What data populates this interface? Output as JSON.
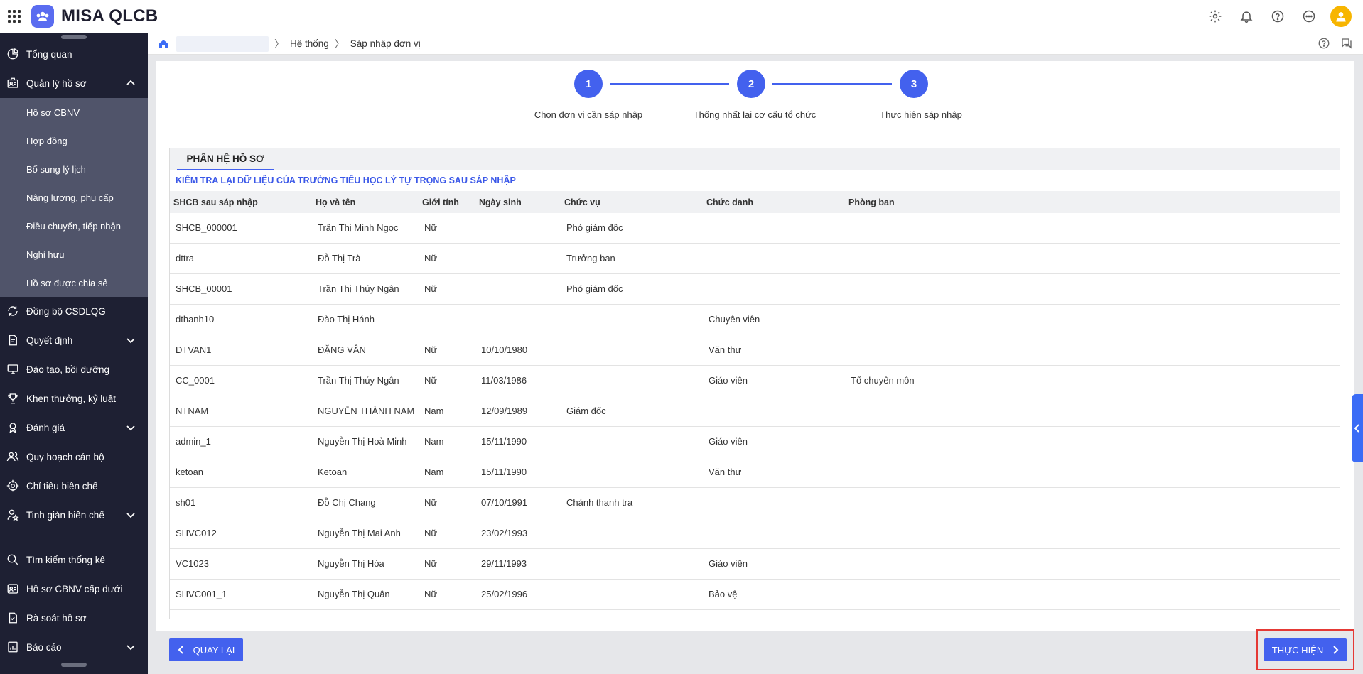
{
  "app": {
    "brand": "MISA QLCB"
  },
  "sidebar": {
    "items": [
      {
        "label": "Tổng quan",
        "icon": "pie-chart-icon"
      },
      {
        "label": "Quản lý hồ sơ",
        "icon": "id-card-icon",
        "expanded": true
      },
      {
        "label": "Đồng bộ CSDLQG",
        "icon": "sync-icon"
      },
      {
        "label": "Quyết định",
        "icon": "document-icon"
      },
      {
        "label": "Đào tạo, bồi dưỡng",
        "icon": "monitor-icon"
      },
      {
        "label": "Khen thưởng, kỷ luật",
        "icon": "trophy-icon"
      },
      {
        "label": "Đánh giá",
        "icon": "medal-icon"
      },
      {
        "label": "Quy hoạch cán bộ",
        "icon": "users-icon"
      },
      {
        "label": "Chỉ tiêu biên chế",
        "icon": "target-icon"
      },
      {
        "label": "Tinh giản biên chế",
        "icon": "user-star-icon"
      },
      {
        "label": "Tìm kiếm thống kê",
        "icon": "search-icon"
      },
      {
        "label": "Hồ sơ CBNV cấp dưới",
        "icon": "profile-card-icon"
      },
      {
        "label": "Rà soát hồ sơ",
        "icon": "review-doc-icon"
      },
      {
        "label": "Báo cáo",
        "icon": "report-icon"
      }
    ],
    "subitems": [
      "Hồ sơ CBNV",
      "Hợp đồng",
      "Bổ sung lý lịch",
      "Nâng lương, phụ cấp",
      "Điều chuyển, tiếp nhận",
      "Nghỉ hưu",
      "Hồ sơ được chia sẻ"
    ]
  },
  "breadcrumb": {
    "level1": "Hệ thống",
    "level2": "Sáp nhập đơn vị"
  },
  "steps": [
    {
      "number": "1",
      "label": "Chọn đơn vị cần sáp nhập"
    },
    {
      "number": "2",
      "label": "Thống nhất lại cơ cấu tổ chức"
    },
    {
      "number": "3",
      "label": "Thực hiện sáp nhập"
    }
  ],
  "module": {
    "tab": "PHÂN HỆ HỒ SƠ",
    "subtitle": "KIỂM TRA LẠI DỮ LIỆU CỦA TRƯỜNG TIỂU HỌC LÝ TỰ TRỌNG SAU SÁP NHẬP"
  },
  "table": {
    "columns": [
      "SHCB sau sáp nhập",
      "Họ và tên",
      "Giới tính",
      "Ngày sinh",
      "Chức vụ",
      "Chức danh",
      "Phòng ban"
    ],
    "rows": [
      [
        "SHCB_000001",
        "Trần Thị Minh Ngọc",
        "Nữ",
        "",
        "Phó giám đốc",
        "",
        ""
      ],
      [
        "dttra",
        "Đỗ Thị Trà",
        "Nữ",
        "",
        "Trưởng ban",
        "",
        ""
      ],
      [
        "SHCB_00001",
        "Trần Thị Thúy Ngân",
        "Nữ",
        "",
        "Phó giám đốc",
        "",
        ""
      ],
      [
        "dthanh10",
        "Đào Thị Hánh",
        "",
        "",
        "",
        "Chuyên viên",
        ""
      ],
      [
        "DTVAN1",
        "ĐẶNG VÂN",
        "Nữ",
        "10/10/1980",
        "",
        "Văn thư",
        ""
      ],
      [
        "CC_0001",
        "Trần Thị Thúy Ngân",
        "Nữ",
        "11/03/1986",
        "",
        "Giáo viên",
        "Tổ chuyên môn"
      ],
      [
        "NTNAM",
        "NGUYỄN THÀNH NAM",
        "Nam",
        "12/09/1989",
        "Giám đốc",
        "",
        ""
      ],
      [
        "admin_1",
        "Nguyễn Thị Hoà Minh",
        "Nam",
        "15/11/1990",
        "",
        "Giáo viên",
        ""
      ],
      [
        "ketoan",
        "Ketoan",
        "Nam",
        "15/11/1990",
        "",
        "Văn thư",
        ""
      ],
      [
        "sh01",
        "Đỗ Chị Chang",
        "Nữ",
        "07/10/1991",
        "Chánh thanh tra",
        "",
        ""
      ],
      [
        "SHVC012",
        "Nguyễn Thị Mai Anh",
        "Nữ",
        "23/02/1993",
        "",
        "",
        ""
      ],
      [
        "VC1023",
        "Nguyễn Thị Hòa",
        "Nữ",
        "29/11/1993",
        "",
        "Giáo viên",
        ""
      ],
      [
        "SHVC001_1",
        "Nguyễn Thị Quân",
        "Nữ",
        "25/02/1996",
        "",
        "Bảo vệ",
        ""
      ]
    ]
  },
  "footer": {
    "back_label": "QUAY LẠI",
    "next_label": "THỰC HIỆN"
  },
  "colors": {
    "primary": "#4361ee",
    "sidebar_bg": "#1e2033",
    "sidebar_sub_bg": "#50546a",
    "highlight": "#e53935"
  }
}
